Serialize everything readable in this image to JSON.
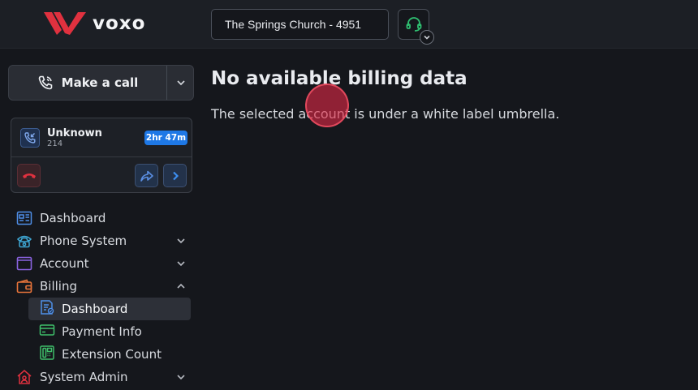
{
  "app": {
    "brand": "voxo"
  },
  "header": {
    "account_selector": "The Springs Church - 4951",
    "support_icon": "headset-icon",
    "support_caret_icon": "chevron-down-icon"
  },
  "sidebar": {
    "call_button": {
      "label": "Make a call",
      "icon": "phone-icon"
    },
    "active_call": {
      "name": "Unknown",
      "extension": "214",
      "duration": "2hr 47m"
    },
    "nav": [
      {
        "label": "Dashboard",
        "icon": "dashboard-icon",
        "expandable": false
      },
      {
        "label": "Phone System",
        "icon": "phone-system-icon",
        "expandable": true,
        "expanded": false
      },
      {
        "label": "Account",
        "icon": "account-icon",
        "expandable": true,
        "expanded": false
      },
      {
        "label": "Billing",
        "icon": "wallet-icon",
        "expandable": true,
        "expanded": true,
        "children": [
          {
            "label": "Dashboard",
            "icon": "billing-dashboard-icon",
            "active": true
          },
          {
            "label": "Payment Info",
            "icon": "credit-card-icon",
            "active": false
          },
          {
            "label": "Extension Count",
            "icon": "extension-count-icon",
            "active": false
          }
        ]
      },
      {
        "label": "System Admin",
        "icon": "system-admin-icon",
        "expandable": true,
        "expanded": false
      }
    ]
  },
  "main": {
    "title": "No available billing data",
    "message": "The selected account is under a white label umbrella."
  },
  "colors": {
    "background": "#15171c",
    "topbar": "#1c1f25",
    "brand_red": "#e0313f",
    "accent_blue": "#1e78e6",
    "support_green": "#2fbf71"
  }
}
